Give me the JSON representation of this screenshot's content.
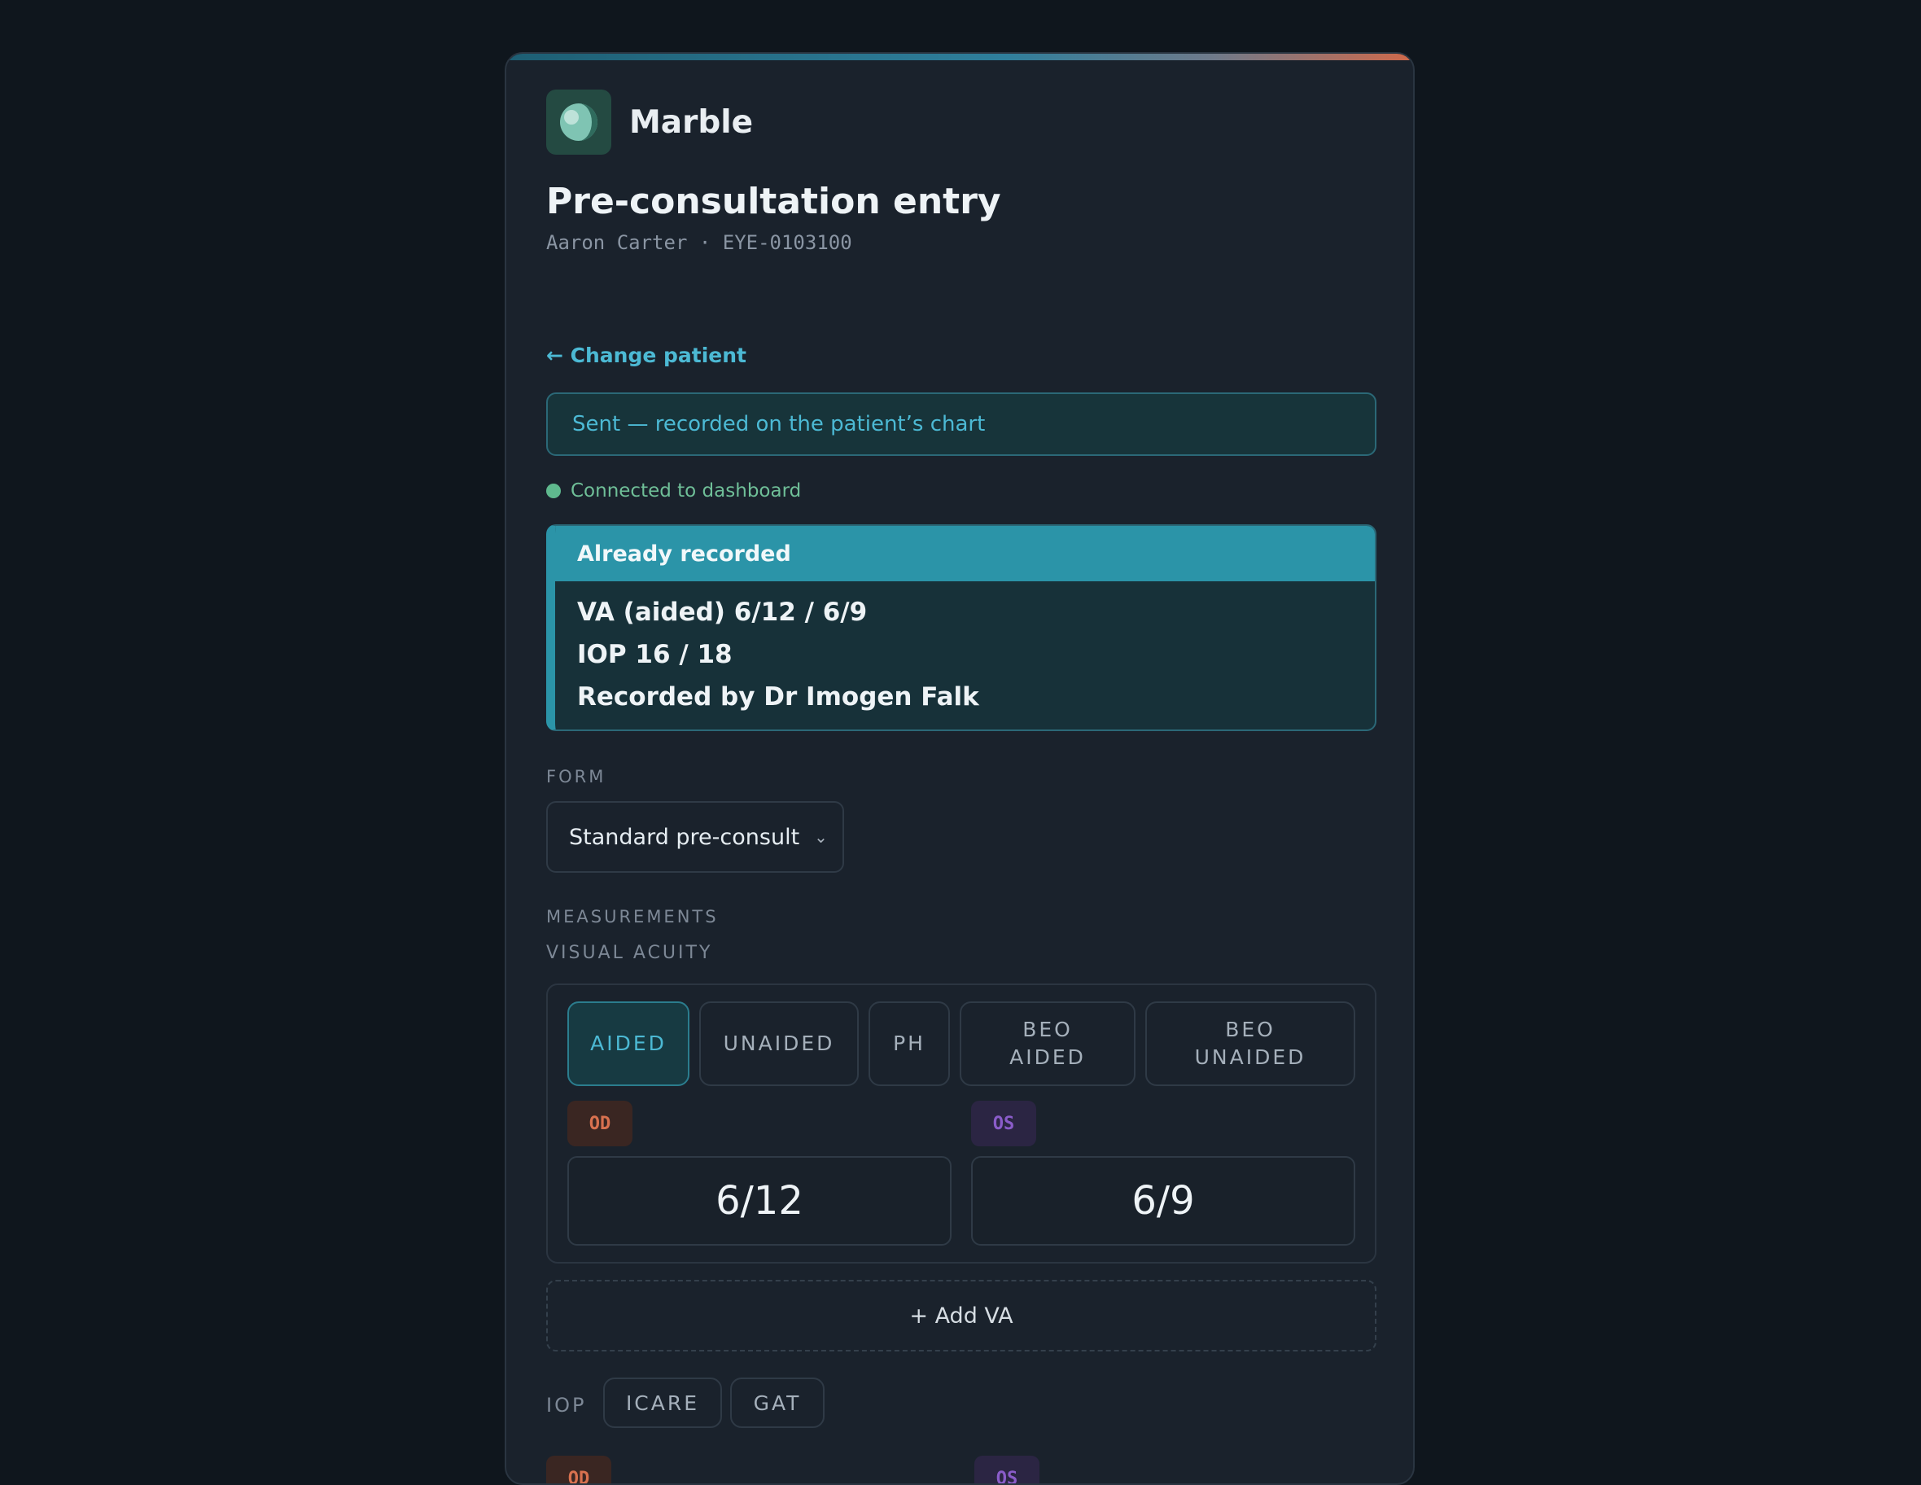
{
  "app": {
    "name": "Marble",
    "logo_icon": "half-moon-icon"
  },
  "header": {
    "title": "Pre-consultation entry",
    "patient_line": "Aaron Carter · EYE-0103100"
  },
  "nav": {
    "change_patient": "← Change patient"
  },
  "banner": {
    "sent": "Sent — recorded on the patient’s chart"
  },
  "status": {
    "connection": "Connected to dashboard",
    "color": "#5fb98e"
  },
  "already_recorded": {
    "heading": "Already recorded",
    "lines": [
      "VA (aided) 6/12 / 6/9",
      "IOP 16 / 18",
      "Recorded by Dr Imogen Falk"
    ]
  },
  "form": {
    "label": "FORM",
    "selected": "Standard pre-consult"
  },
  "measurements": {
    "label": "MEASUREMENTS",
    "visual_acuity": {
      "label": "VISUAL ACUITY",
      "tabs": [
        "AIDED",
        "UNAIDED",
        "PH",
        "BEO AIDED",
        "BEO UNAIDED"
      ],
      "active_tab": "AIDED",
      "od_label": "OD",
      "os_label": "OS",
      "od_value": "6/12",
      "os_value": "6/9",
      "add_button": "+ Add VA"
    },
    "iop": {
      "label": "IOP",
      "methods": [
        "ICARE",
        "GAT"
      ],
      "od_label": "OD",
      "os_label": "OS"
    }
  },
  "colors": {
    "accent": "#4cb9d4",
    "od": "#d8714f",
    "os": "#8a5cc9",
    "background": "#0f161d"
  }
}
